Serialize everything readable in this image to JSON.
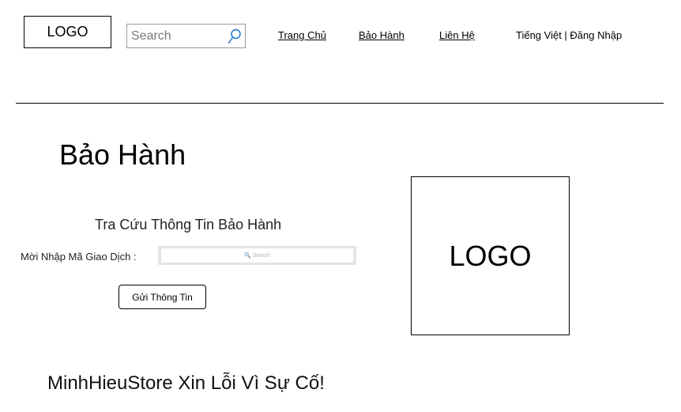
{
  "header": {
    "logo_text": "LOGO",
    "search": {
      "placeholder": "Search",
      "icon": "search-icon",
      "icon_color": "#1a73c9"
    },
    "nav": {
      "home": "Trang Chủ",
      "warranty": "Bảo Hành",
      "contact": "Liên Hệ"
    },
    "language_login": "Tiếng Việt | Đăng Nhập"
  },
  "main": {
    "page_title": "Bảo Hành",
    "section_title": "Tra Cứu Thông Tin Bảo Hành",
    "field_label": "Mời Nhập Mã Giao Dịch :",
    "code_input_placeholder": "🔍 Search",
    "submit_label": "Gửi Thông Tin",
    "logo_text": "LOGO"
  },
  "footer": {
    "message": "MinhHieuStore Xin Lỗi Vì Sự Cố!"
  }
}
